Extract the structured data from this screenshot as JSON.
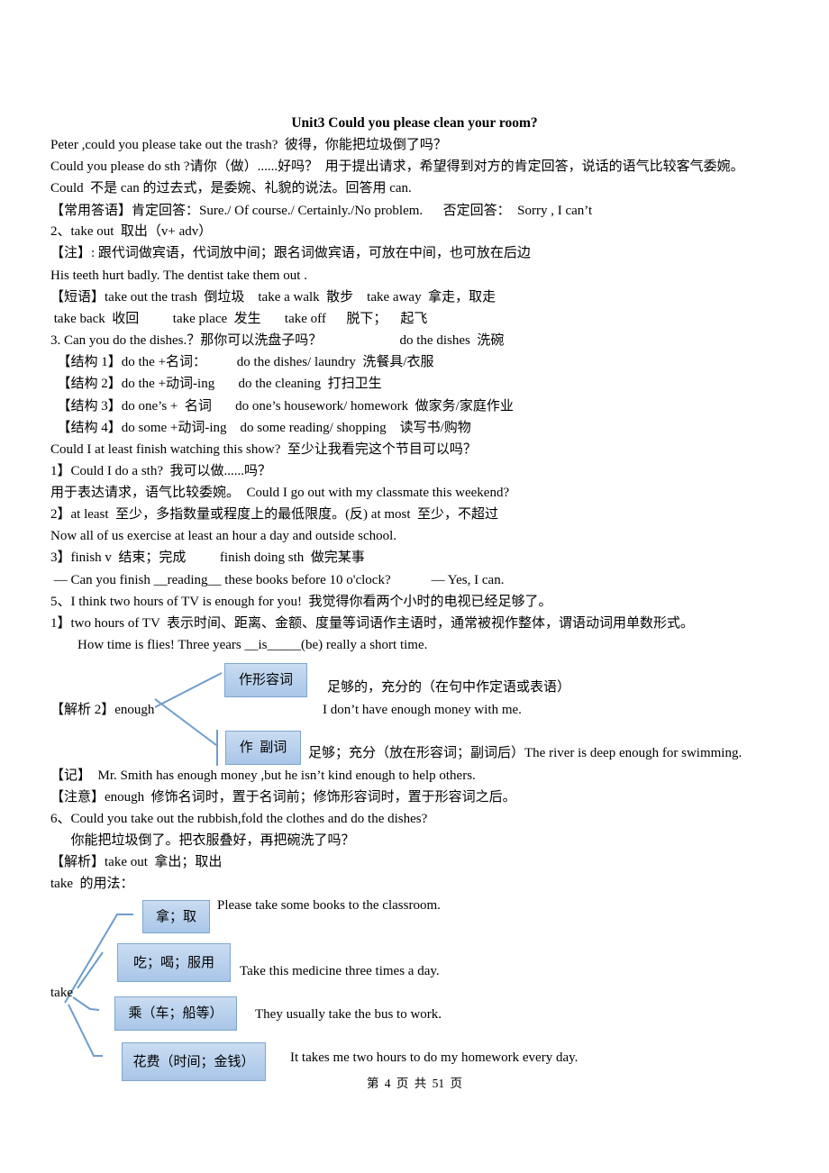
{
  "document": {
    "title": "Unit3 Could you please clean your room?",
    "lines": [
      "Peter ,could you please take out the trash?  彼得，你能把垃圾倒了吗？",
      "Could you please do sth ?请你（做）......好吗？  用于提出请求，希望得到对方的肯定回答，说话的语气比较客气委婉。",
      "Could  不是 can 的过去式，是委婉、礼貌的说法。回答用 can.",
      "【常用答语】肯定回答：Sure./ Of course./ Certainly./No problem.      否定回答：  Sorry , I can’t",
      "2、take out  取出（v+ adv）",
      "【注】: 跟代词做宾语，代词放中间；跟名词做宾语，可放在中间，也可放在后边",
      "His teeth hurt badly. The dentist take them out .",
      "【短语】take out the trash  倒垃圾    take a walk  散步    take away  拿走，取走",
      " take back  收回          take place  发生       take off      脱下；    起飞",
      "3. Can you do the dishes.？那你可以洗盘子吗？                       do the dishes  洗碗",
      "  【结构 1】do the +名词：         do the dishes/ laundry  洗餐具/衣服",
      "  【结构 2】do the +动词-ing       do the cleaning  打扫卫生",
      "  【结构 3】do one’s +  名词       do one’s housework/ homework  做家务/家庭作业",
      "  【结构 4】do some +动词-ing    do some reading/ shopping    读写书/购物",
      "Could I at least finish watching this show?  至少让我看完这个节目可以吗？",
      "1】Could I do a sth?  我可以做......吗？",
      "用于表达请求，语气比较委婉。  Could I go out with my classmate this weekend?",
      "2】at least  至少，多指数量或程度上的最低限度。(反) at most  至少，不超过",
      "Now all of us exercise at least an hour a day and outside school.",
      "3】finish v  结束；完成          finish doing sth  做完某事",
      " — Can you finish __reading__ these books before 10 o'clock?            — Yes, I can.",
      "5、I think two hours of TV is enough for you!  我觉得你看两个小时的电视已经足够了。",
      "1】two hours of TV  表示时间、距离、金额、度量等词语作主语时，通常被视作整体，谓语动词用单数形式。",
      "        How time is flies! Three years __is_____(be) really a short time."
    ],
    "enough_diagram": {
      "label": "【解析 2】enough",
      "branches": [
        {
          "box": "作形容词",
          "meaning": "足够的，充分的（在句中作定语或表语）",
          "example": "I don’t have enough money with me."
        },
        {
          "box": "作  副词",
          "meaning": "足够；充分（放在形容词；副词后）The river is deep enough for swimming."
        }
      ]
    },
    "lines_after": [
      "【记】  Mr. Smith has enough money ,but he isn’t kind enough to help others.",
      "【注意】enough  修饰名词时，置于名词前；修饰形容词时，置于形容词之后。",
      "6、Could you take out the rubbish,fold the clothes and do the dishes?",
      "      你能把垃圾倒了。把衣服叠好，再把碗洗了吗？",
      "【解析】take out  拿出；取出",
      "take  的用法："
    ],
    "take_diagram": {
      "label": "take",
      "branches": [
        {
          "box": "拿；取",
          "example": "Please take some books to the classroom."
        },
        {
          "box": "吃；喝；服用",
          "example": "Take this medicine three times a day."
        },
        {
          "box": "乘（车；船等）",
          "example": "They usually take the bus to work."
        },
        {
          "box": "花费（时间；金钱）",
          "example": "It takes me two hours to do my homework every day."
        }
      ]
    },
    "footer": "第 4 页 共 51 页"
  },
  "colors": {
    "box_border": "#7ea6d0",
    "box_fill": "#b9d1ed",
    "connector": "#6f9ccb"
  }
}
